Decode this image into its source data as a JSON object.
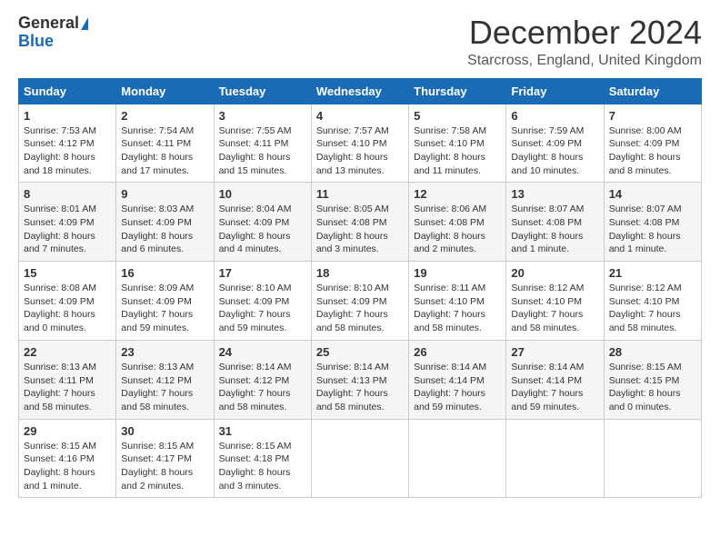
{
  "logo": {
    "general": "General",
    "blue": "Blue"
  },
  "title": "December 2024",
  "subtitle": "Starcross, England, United Kingdom",
  "days_of_week": [
    "Sunday",
    "Monday",
    "Tuesday",
    "Wednesday",
    "Thursday",
    "Friday",
    "Saturday"
  ],
  "weeks": [
    [
      {
        "day": "1",
        "sunrise": "Sunrise: 7:53 AM",
        "sunset": "Sunset: 4:12 PM",
        "daylight": "Daylight: 8 hours and 18 minutes."
      },
      {
        "day": "2",
        "sunrise": "Sunrise: 7:54 AM",
        "sunset": "Sunset: 4:11 PM",
        "daylight": "Daylight: 8 hours and 17 minutes."
      },
      {
        "day": "3",
        "sunrise": "Sunrise: 7:55 AM",
        "sunset": "Sunset: 4:11 PM",
        "daylight": "Daylight: 8 hours and 15 minutes."
      },
      {
        "day": "4",
        "sunrise": "Sunrise: 7:57 AM",
        "sunset": "Sunset: 4:10 PM",
        "daylight": "Daylight: 8 hours and 13 minutes."
      },
      {
        "day": "5",
        "sunrise": "Sunrise: 7:58 AM",
        "sunset": "Sunset: 4:10 PM",
        "daylight": "Daylight: 8 hours and 11 minutes."
      },
      {
        "day": "6",
        "sunrise": "Sunrise: 7:59 AM",
        "sunset": "Sunset: 4:09 PM",
        "daylight": "Daylight: 8 hours and 10 minutes."
      },
      {
        "day": "7",
        "sunrise": "Sunrise: 8:00 AM",
        "sunset": "Sunset: 4:09 PM",
        "daylight": "Daylight: 8 hours and 8 minutes."
      }
    ],
    [
      {
        "day": "8",
        "sunrise": "Sunrise: 8:01 AM",
        "sunset": "Sunset: 4:09 PM",
        "daylight": "Daylight: 8 hours and 7 minutes."
      },
      {
        "day": "9",
        "sunrise": "Sunrise: 8:03 AM",
        "sunset": "Sunset: 4:09 PM",
        "daylight": "Daylight: 8 hours and 6 minutes."
      },
      {
        "day": "10",
        "sunrise": "Sunrise: 8:04 AM",
        "sunset": "Sunset: 4:09 PM",
        "daylight": "Daylight: 8 hours and 4 minutes."
      },
      {
        "day": "11",
        "sunrise": "Sunrise: 8:05 AM",
        "sunset": "Sunset: 4:08 PM",
        "daylight": "Daylight: 8 hours and 3 minutes."
      },
      {
        "day": "12",
        "sunrise": "Sunrise: 8:06 AM",
        "sunset": "Sunset: 4:08 PM",
        "daylight": "Daylight: 8 hours and 2 minutes."
      },
      {
        "day": "13",
        "sunrise": "Sunrise: 8:07 AM",
        "sunset": "Sunset: 4:08 PM",
        "daylight": "Daylight: 8 hours and 1 minute."
      },
      {
        "day": "14",
        "sunrise": "Sunrise: 8:07 AM",
        "sunset": "Sunset: 4:08 PM",
        "daylight": "Daylight: 8 hours and 1 minute."
      }
    ],
    [
      {
        "day": "15",
        "sunrise": "Sunrise: 8:08 AM",
        "sunset": "Sunset: 4:09 PM",
        "daylight": "Daylight: 8 hours and 0 minutes."
      },
      {
        "day": "16",
        "sunrise": "Sunrise: 8:09 AM",
        "sunset": "Sunset: 4:09 PM",
        "daylight": "Daylight: 7 hours and 59 minutes."
      },
      {
        "day": "17",
        "sunrise": "Sunrise: 8:10 AM",
        "sunset": "Sunset: 4:09 PM",
        "daylight": "Daylight: 7 hours and 59 minutes."
      },
      {
        "day": "18",
        "sunrise": "Sunrise: 8:10 AM",
        "sunset": "Sunset: 4:09 PM",
        "daylight": "Daylight: 7 hours and 58 minutes."
      },
      {
        "day": "19",
        "sunrise": "Sunrise: 8:11 AM",
        "sunset": "Sunset: 4:10 PM",
        "daylight": "Daylight: 7 hours and 58 minutes."
      },
      {
        "day": "20",
        "sunrise": "Sunrise: 8:12 AM",
        "sunset": "Sunset: 4:10 PM",
        "daylight": "Daylight: 7 hours and 58 minutes."
      },
      {
        "day": "21",
        "sunrise": "Sunrise: 8:12 AM",
        "sunset": "Sunset: 4:10 PM",
        "daylight": "Daylight: 7 hours and 58 minutes."
      }
    ],
    [
      {
        "day": "22",
        "sunrise": "Sunrise: 8:13 AM",
        "sunset": "Sunset: 4:11 PM",
        "daylight": "Daylight: 7 hours and 58 minutes."
      },
      {
        "day": "23",
        "sunrise": "Sunrise: 8:13 AM",
        "sunset": "Sunset: 4:12 PM",
        "daylight": "Daylight: 7 hours and 58 minutes."
      },
      {
        "day": "24",
        "sunrise": "Sunrise: 8:14 AM",
        "sunset": "Sunset: 4:12 PM",
        "daylight": "Daylight: 7 hours and 58 minutes."
      },
      {
        "day": "25",
        "sunrise": "Sunrise: 8:14 AM",
        "sunset": "Sunset: 4:13 PM",
        "daylight": "Daylight: 7 hours and 58 minutes."
      },
      {
        "day": "26",
        "sunrise": "Sunrise: 8:14 AM",
        "sunset": "Sunset: 4:14 PM",
        "daylight": "Daylight: 7 hours and 59 minutes."
      },
      {
        "day": "27",
        "sunrise": "Sunrise: 8:14 AM",
        "sunset": "Sunset: 4:14 PM",
        "daylight": "Daylight: 7 hours and 59 minutes."
      },
      {
        "day": "28",
        "sunrise": "Sunrise: 8:15 AM",
        "sunset": "Sunset: 4:15 PM",
        "daylight": "Daylight: 8 hours and 0 minutes."
      }
    ],
    [
      {
        "day": "29",
        "sunrise": "Sunrise: 8:15 AM",
        "sunset": "Sunset: 4:16 PM",
        "daylight": "Daylight: 8 hours and 1 minute."
      },
      {
        "day": "30",
        "sunrise": "Sunrise: 8:15 AM",
        "sunset": "Sunset: 4:17 PM",
        "daylight": "Daylight: 8 hours and 2 minutes."
      },
      {
        "day": "31",
        "sunrise": "Sunrise: 8:15 AM",
        "sunset": "Sunset: 4:18 PM",
        "daylight": "Daylight: 8 hours and 3 minutes."
      },
      null,
      null,
      null,
      null
    ]
  ]
}
